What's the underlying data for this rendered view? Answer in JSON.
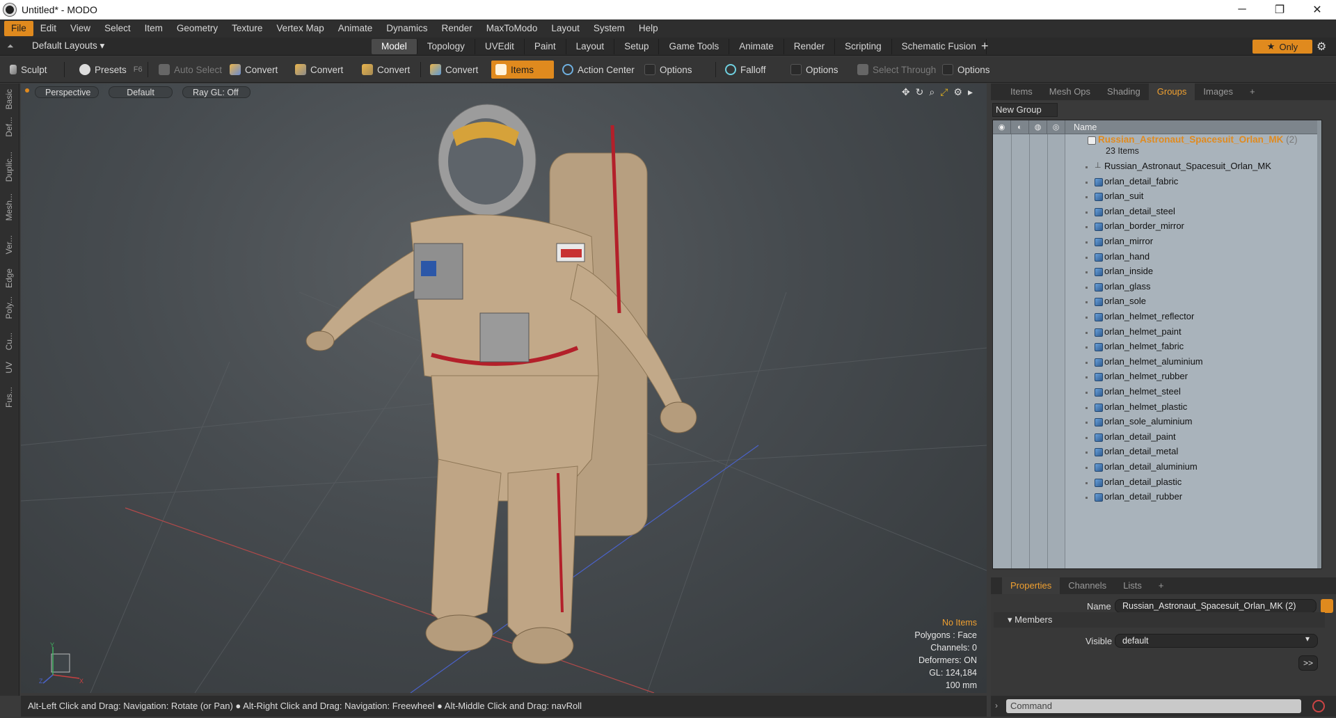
{
  "window": {
    "title": "Untitled* - MODO",
    "controls": [
      "─",
      "❐",
      "✕"
    ]
  },
  "menu": [
    "File",
    "Edit",
    "View",
    "Select",
    "Item",
    "Geometry",
    "Texture",
    "Vertex Map",
    "Animate",
    "Dynamics",
    "Render",
    "MaxToModo",
    "Layout",
    "System",
    "Help"
  ],
  "layout_bar": {
    "default_layouts": "Default Layouts ▾",
    "tabs": [
      "Model",
      "Topology",
      "UVEdit",
      "Paint",
      "Layout",
      "Setup",
      "Game Tools",
      "Animate",
      "Render",
      "Scripting",
      "Schematic Fusion"
    ],
    "plus": "+",
    "only": "Only"
  },
  "toolbar": {
    "sculpt": "Sculpt",
    "presets": "Presets",
    "presets_key": "F6",
    "auto_select": "Auto Select",
    "convert": "Convert",
    "items": "Items",
    "action_center": "Action Center",
    "options": "Options",
    "falloff": "Falloff",
    "select_through": "Select Through"
  },
  "left_tabs": [
    "Basic",
    "Def...",
    "Duplic...",
    "Mesh...",
    "Ver...",
    "Edge",
    "Poly...",
    "Cu...",
    "UV",
    "Fus..."
  ],
  "viewport": {
    "perspective": "Perspective",
    "shading": "Default",
    "raygl": "Ray GL: Off",
    "hud": {
      "no_items": "No Items",
      "polygons": "Polygons : Face",
      "channels": "Channels: 0",
      "deformers": "Deformers: ON",
      "gl": "GL: 124,184",
      "scale": "100 mm"
    }
  },
  "groups_panel": {
    "tabs": [
      "Items",
      "Mesh Ops",
      "Shading",
      "Groups",
      "Images"
    ],
    "active_tab": "Groups",
    "new_group": "New Group",
    "column_name": "Name",
    "group": {
      "name": "Russian_Astronaut_Spacesuit_Orlan_MK",
      "suffix": "(2)",
      "count": "23 Items"
    },
    "items": [
      "Russian_Astronaut_Spacesuit_Orlan_MK",
      "orlan_detail_fabric",
      "orlan_suit",
      "orlan_detail_steel",
      "orlan_border_mirror",
      "orlan_mirror",
      "orlan_hand",
      "orlan_inside",
      "orlan_glass",
      "orlan_sole",
      "orlan_helmet_reflector",
      "orlan_helmet_paint",
      "orlan_helmet_fabric",
      "orlan_helmet_aluminium",
      "orlan_helmet_rubber",
      "orlan_helmet_steel",
      "orlan_helmet_plastic",
      "orlan_sole_aluminium",
      "orlan_detail_paint",
      "orlan_detail_metal",
      "orlan_detail_aluminium",
      "orlan_detail_plastic",
      "orlan_detail_rubber"
    ]
  },
  "properties": {
    "tabs": [
      "Properties",
      "Channels",
      "Lists"
    ],
    "name_label": "Name",
    "name_value": "Russian_Astronaut_Spacesuit_Orlan_MK (2)",
    "members": "Members",
    "visible_label": "Visible",
    "visible_value": "default",
    "more": ">>"
  },
  "status": "Alt-Left Click and Drag: Navigation: Rotate (or Pan) ● Alt-Right Click and Drag: Navigation: Freewheel ● Alt-Middle Click and Drag: navRoll",
  "command_placeholder": "Command",
  "colors": {
    "accent": "#e08a1e",
    "group_name": "#e08a1e",
    "list_bg": "#a9b3bb"
  }
}
